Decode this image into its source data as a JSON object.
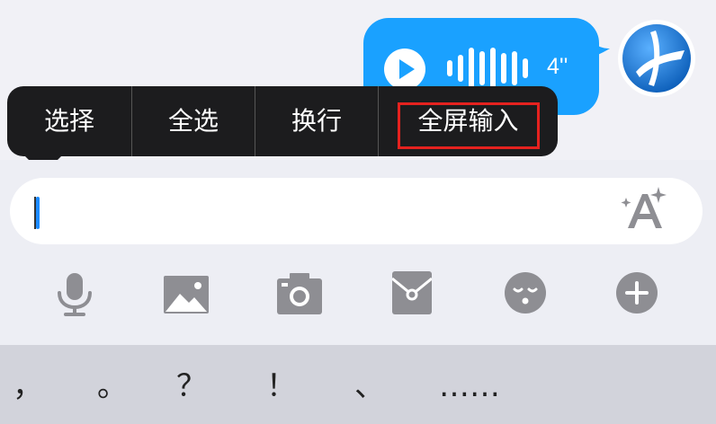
{
  "message": {
    "duration": "4''"
  },
  "context_menu": {
    "items": [
      "选择",
      "全选",
      "换行",
      "全屏输入"
    ],
    "highlighted_item": "全屏输入"
  },
  "input": {
    "value": "",
    "format_icon": "text-format-sparkle-icon"
  },
  "toolbar": {
    "icons": [
      "microphone-icon",
      "image-icon",
      "camera-icon",
      "red-envelope-icon",
      "emoji-icon",
      "plus-icon"
    ]
  },
  "keyboard": {
    "keys": [
      "，",
      "。",
      "？",
      "！",
      "、",
      "……"
    ]
  },
  "colors": {
    "bubble": "#1aa1ff",
    "menu": "#1c1c1e",
    "highlight": "#e5221f",
    "cursor": "#1c8cff"
  }
}
